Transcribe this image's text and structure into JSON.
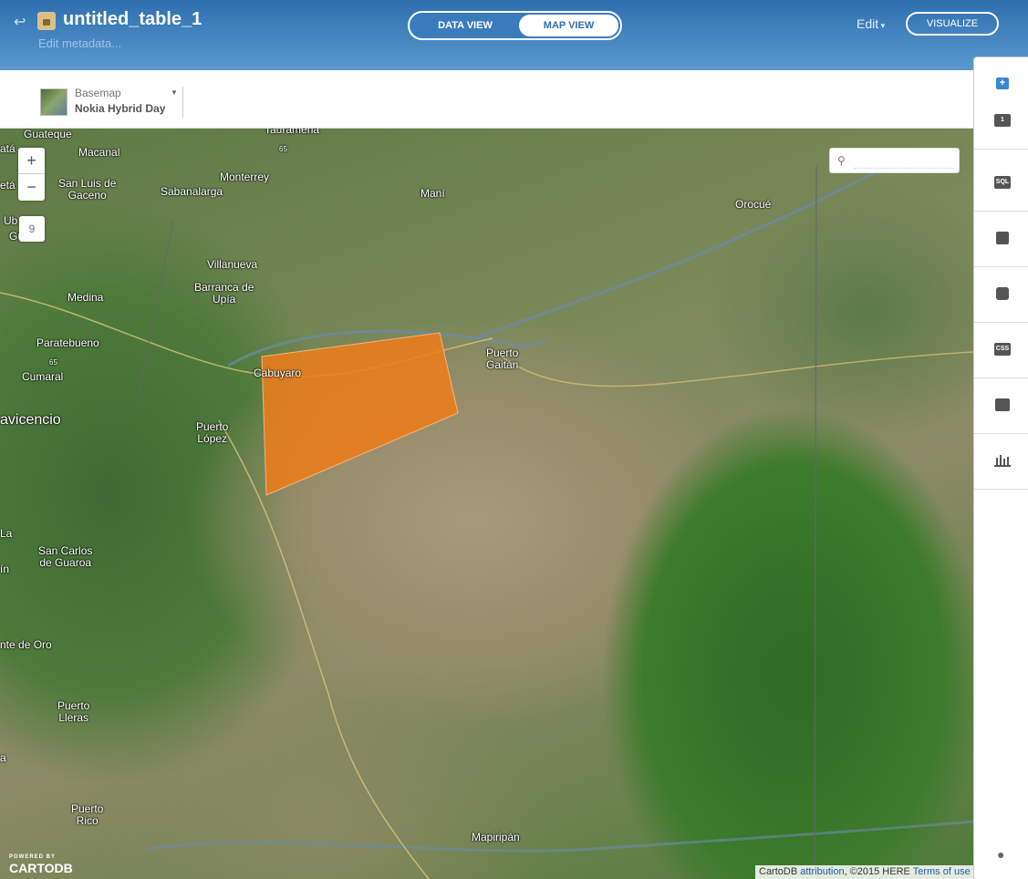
{
  "header": {
    "back_icon": "back-arrow-icon",
    "lock_icon": "lock-icon",
    "title": "untitled_table_1",
    "metadata_link": "Edit metadata...",
    "tabs": [
      {
        "label": "DATA VIEW",
        "active": false
      },
      {
        "label": "MAP VIEW",
        "active": true
      }
    ],
    "edit_label": "Edit",
    "visualize_label": "VISUALIZE"
  },
  "toolbar": {
    "basemap_label": "Basemap",
    "basemap_name": "Nokia Hybrid Day"
  },
  "map": {
    "zoom_in": "+",
    "zoom_out": "−",
    "zoom_level": "9",
    "search_placeholder": "",
    "polygon_color": "#ef7d1a",
    "places": [
      {
        "name": "Guateque"
      },
      {
        "name": "Macanal"
      },
      {
        "name": "Tauramena"
      },
      {
        "name": "65"
      },
      {
        "name": "San Luis de\nGaceno"
      },
      {
        "name": "Sabanalarga"
      },
      {
        "name": "Monterrey"
      },
      {
        "name": "Maní"
      },
      {
        "name": "Orocué"
      },
      {
        "name": "Villanueva"
      },
      {
        "name": "Barranca de\nUpía"
      },
      {
        "name": "Medina"
      },
      {
        "name": "Paratebueno"
      },
      {
        "name": "65"
      },
      {
        "name": "Cumaral"
      },
      {
        "name": "Cabuyaro"
      },
      {
        "name": "Puerto\nGaitán"
      },
      {
        "name": "avicencio"
      },
      {
        "name": "Puerto\nLópez"
      },
      {
        "name": "San Carlos\nde Guaroa"
      },
      {
        "name": "nte de Oro"
      },
      {
        "name": "Puerto\nLleras"
      },
      {
        "name": "Puerto\nRico"
      },
      {
        "name": "Mapiripán"
      },
      {
        "name": "etá"
      },
      {
        "name": "atá"
      },
      {
        "name": "Ub"
      },
      {
        "name": "Gu"
      },
      {
        "name": "La"
      },
      {
        "name": "ín"
      },
      {
        "name": "a"
      }
    ],
    "logo_small": "POWERED BY",
    "logo": "CARTODB",
    "attribution": {
      "prefix": "CartoDB",
      "link1": "attribution",
      "middle": ", ©2015 HERE",
      "link2": "Terms of use"
    }
  },
  "right_panel": {
    "add_layer": "+",
    "layer_number": "1",
    "tools": [
      {
        "icon": "layer-number-icon",
        "text": "1"
      },
      {
        "icon": "sql-icon",
        "text": "SQL"
      },
      {
        "icon": "wizard-brush-icon",
        "text": ""
      },
      {
        "icon": "infowindow-icon",
        "text": ""
      },
      {
        "icon": "css-icon",
        "text": "CSS"
      },
      {
        "icon": "legend-icon",
        "text": ""
      },
      {
        "icon": "filters-icon",
        "text": ""
      }
    ],
    "bottom_icon": "lightbulb-icon"
  }
}
